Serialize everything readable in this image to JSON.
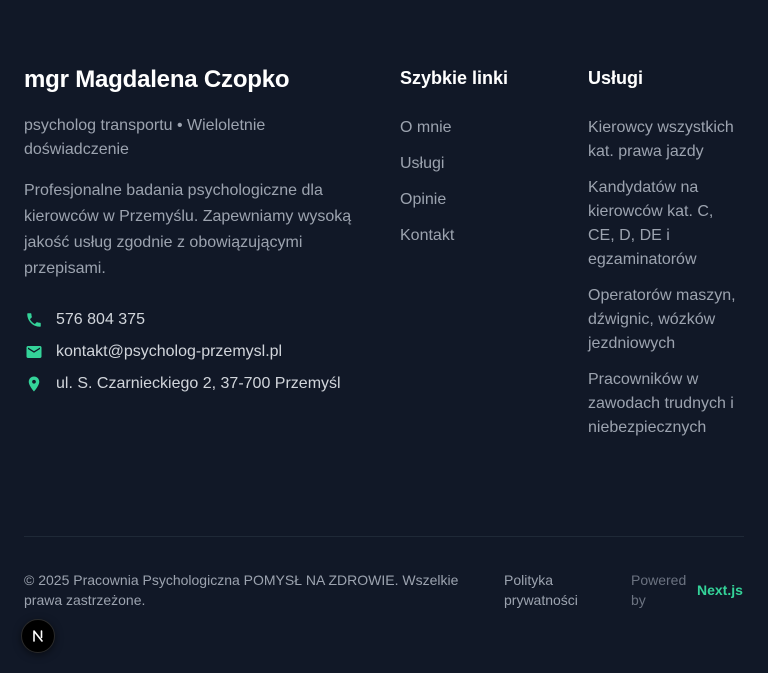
{
  "brand": {
    "name": "mgr Magdalena Czopko",
    "tagline": "psycholog transportu • Wieloletnie doświadczenie",
    "description": "Profesjonalne badania psychologiczne dla kierowców w Przemyślu. Zapewniamy wysoką jakość usług zgodnie z obowiązującymi przepisami."
  },
  "contact": {
    "phone": "576 804 375",
    "email": "kontakt@psycholog-przemysl.pl",
    "address": "ul. S. Czarnieckiego 2, 37-700 Przemyśl"
  },
  "quick_links": {
    "title": "Szybkie linki",
    "items": [
      {
        "label": "O mnie"
      },
      {
        "label": "Usługi"
      },
      {
        "label": "Opinie"
      },
      {
        "label": "Kontakt"
      }
    ]
  },
  "services": {
    "title": "Usługi",
    "items": [
      "Kierowcy wszystkich kat. prawa jazdy",
      "Kandydatów na kierowców kat. C, CE, D, DE i egzaminatorów",
      "Operatorów maszyn, dźwignic, wózków jezdniowych",
      "Pracowników w zawodach trudnych i niebezpiecznych"
    ]
  },
  "bottom": {
    "copyright": "© 2025 Pracownia Psychologiczna POMYSŁ NA ZDROWIE. Wszelkie prawa zastrzeżone.",
    "privacy": "Polityka prywatności",
    "powered_by": "Powered by",
    "framework": "Next.js"
  },
  "icons": {
    "phone": "phone-icon",
    "email": "mail-icon",
    "address": "map-pin-icon",
    "badge": "nextjs-logo-icon"
  },
  "colors": {
    "background": "#111827",
    "accent": "#34d399",
    "heading": "#ffffff",
    "text": "#9ca3af"
  }
}
